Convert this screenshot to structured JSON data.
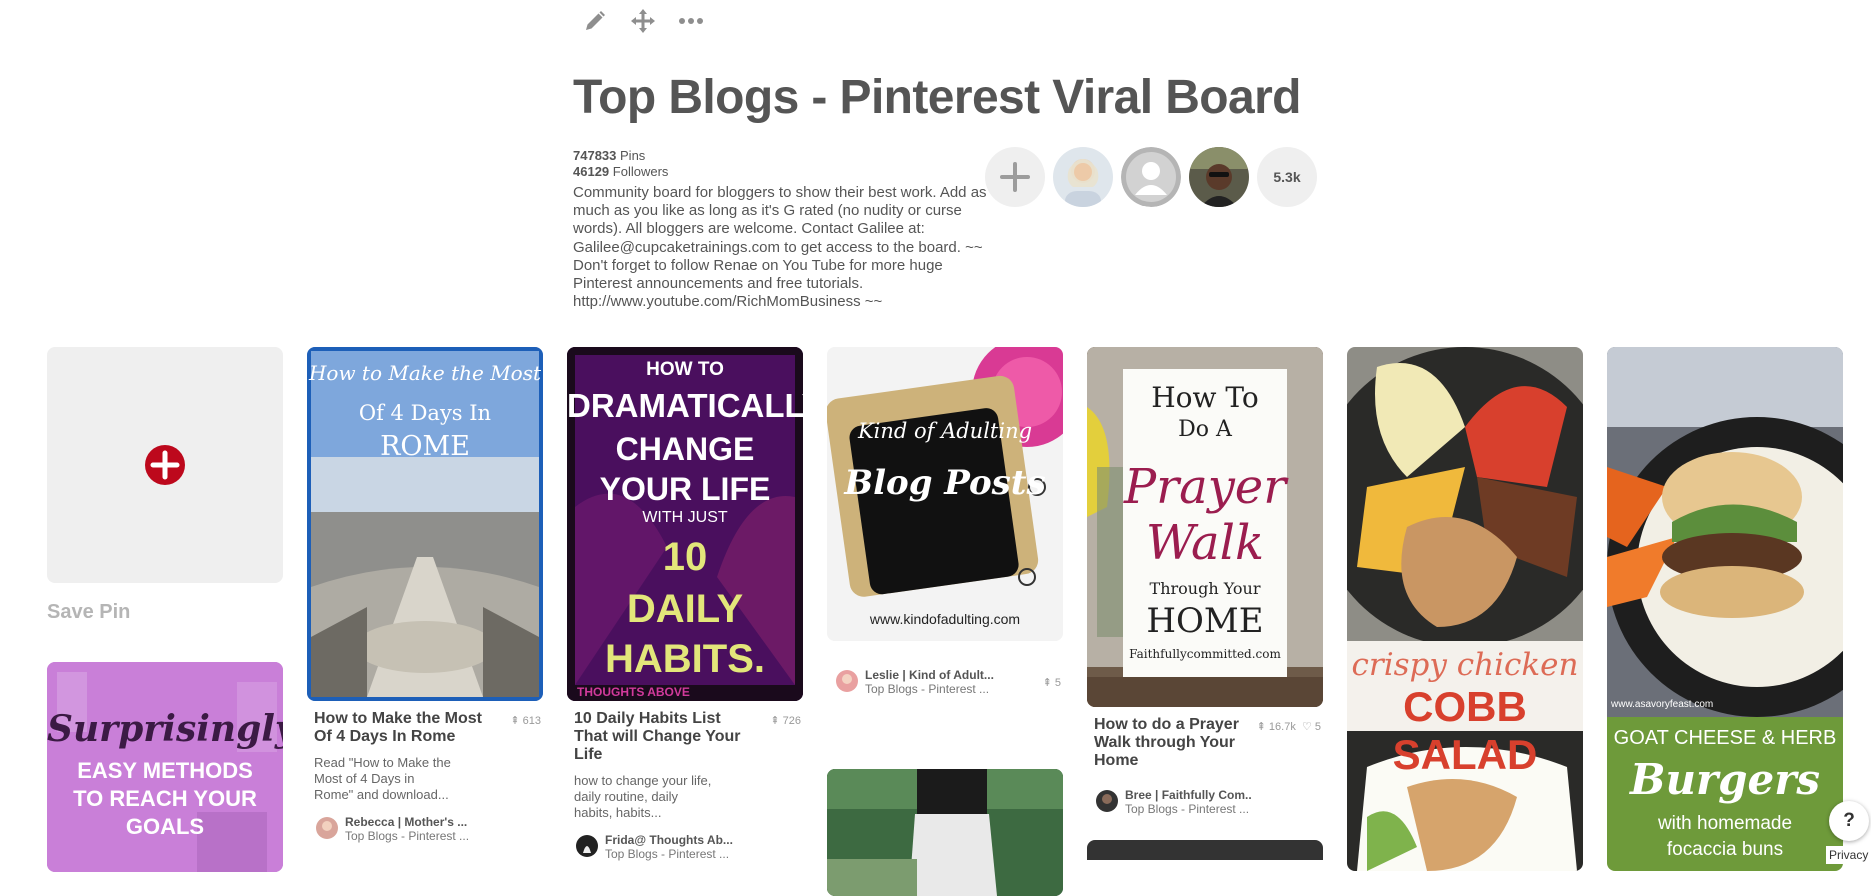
{
  "board": {
    "title": "Top Blogs - Pinterest Viral Board",
    "pins_count": "747833",
    "pins_label": "Pins",
    "followers_count": "46129",
    "followers_label": "Followers",
    "description": "Community board for bloggers to show their best work. Add as much as you like as long as it's G rated (no nudity or curse words). All bloggers are welcome. Contact Galilee at: Galilee@cupcaketrainings.com to get access to the board. ~~ Don't forget to follow Renae on You Tube for more huge Pinterest announcements and free tutorials. http://www.youtube.com/RichMomBusiness ~~",
    "collaborator_count": "5.3k"
  },
  "toolbar": {
    "icons": [
      "pencil-icon",
      "move-icon",
      "more-icon"
    ]
  },
  "save_pin": {
    "label": "Save Pin"
  },
  "pins": {
    "rome": {
      "overlay": [
        "How to Make the Most",
        "Of 4 Days In",
        "ROME"
      ],
      "title": "How to Make the Most Of 4 Days In Rome",
      "repins": "613",
      "desc": "Read \"How to Make the Most of 4 Days in Rome\" and download...",
      "user": "Rebecca | Mother's ...",
      "board": "Top Blogs - Pinterest ..."
    },
    "habits": {
      "overlay": [
        "HOW TO",
        "DRAMATICALLY",
        "CHANGE",
        "YOUR LIFE",
        "WITH JUST",
        "10",
        "DAILY",
        "HABITS."
      ],
      "footer": "THOUGHTS ABOVE",
      "title": "10 Daily Habits List That will Change Your Life",
      "repins": "726",
      "desc": "how to change your life, daily routine, daily habits, habits...",
      "user": "Frida@ Thoughts Ab...",
      "board": "Top Blogs - Pinterest ..."
    },
    "adulting": {
      "overlay": [
        "Kind of Adulting",
        "Blog Posts"
      ],
      "url": "www.kindofadulting.com",
      "repins": "5",
      "user": "Leslie | Kind of Adult...",
      "board": "Top Blogs - Pinterest ..."
    },
    "prayer": {
      "overlay": [
        "How To",
        "Do A",
        "Prayer",
        "Walk",
        "Through Your",
        "HOME"
      ],
      "url": "Faithfullycommitted.com",
      "title": "How to do a Prayer Walk through Your Home",
      "repins": "16.7k",
      "likes": "5",
      "user": "Bree | Faithfully Com..",
      "board": "Top Blogs - Pinterest ..."
    },
    "cobb": {
      "overlay": [
        "crispy chicken",
        "COBB SALAD"
      ]
    },
    "burger": {
      "url": "www.asavoryfeast.com",
      "overlay": [
        "GOAT CHEESE & HERB",
        "Burgers",
        "with homemade",
        "focaccia buns"
      ]
    },
    "goals": {
      "overlay": [
        "Surprisingly",
        "EASY METHODS",
        "TO REACH YOUR",
        "GOALS"
      ]
    }
  },
  "footer": {
    "help": "?",
    "privacy": "Privacy"
  },
  "colors": {
    "save_red": "#bd081c",
    "panel_grey": "#efefef"
  }
}
